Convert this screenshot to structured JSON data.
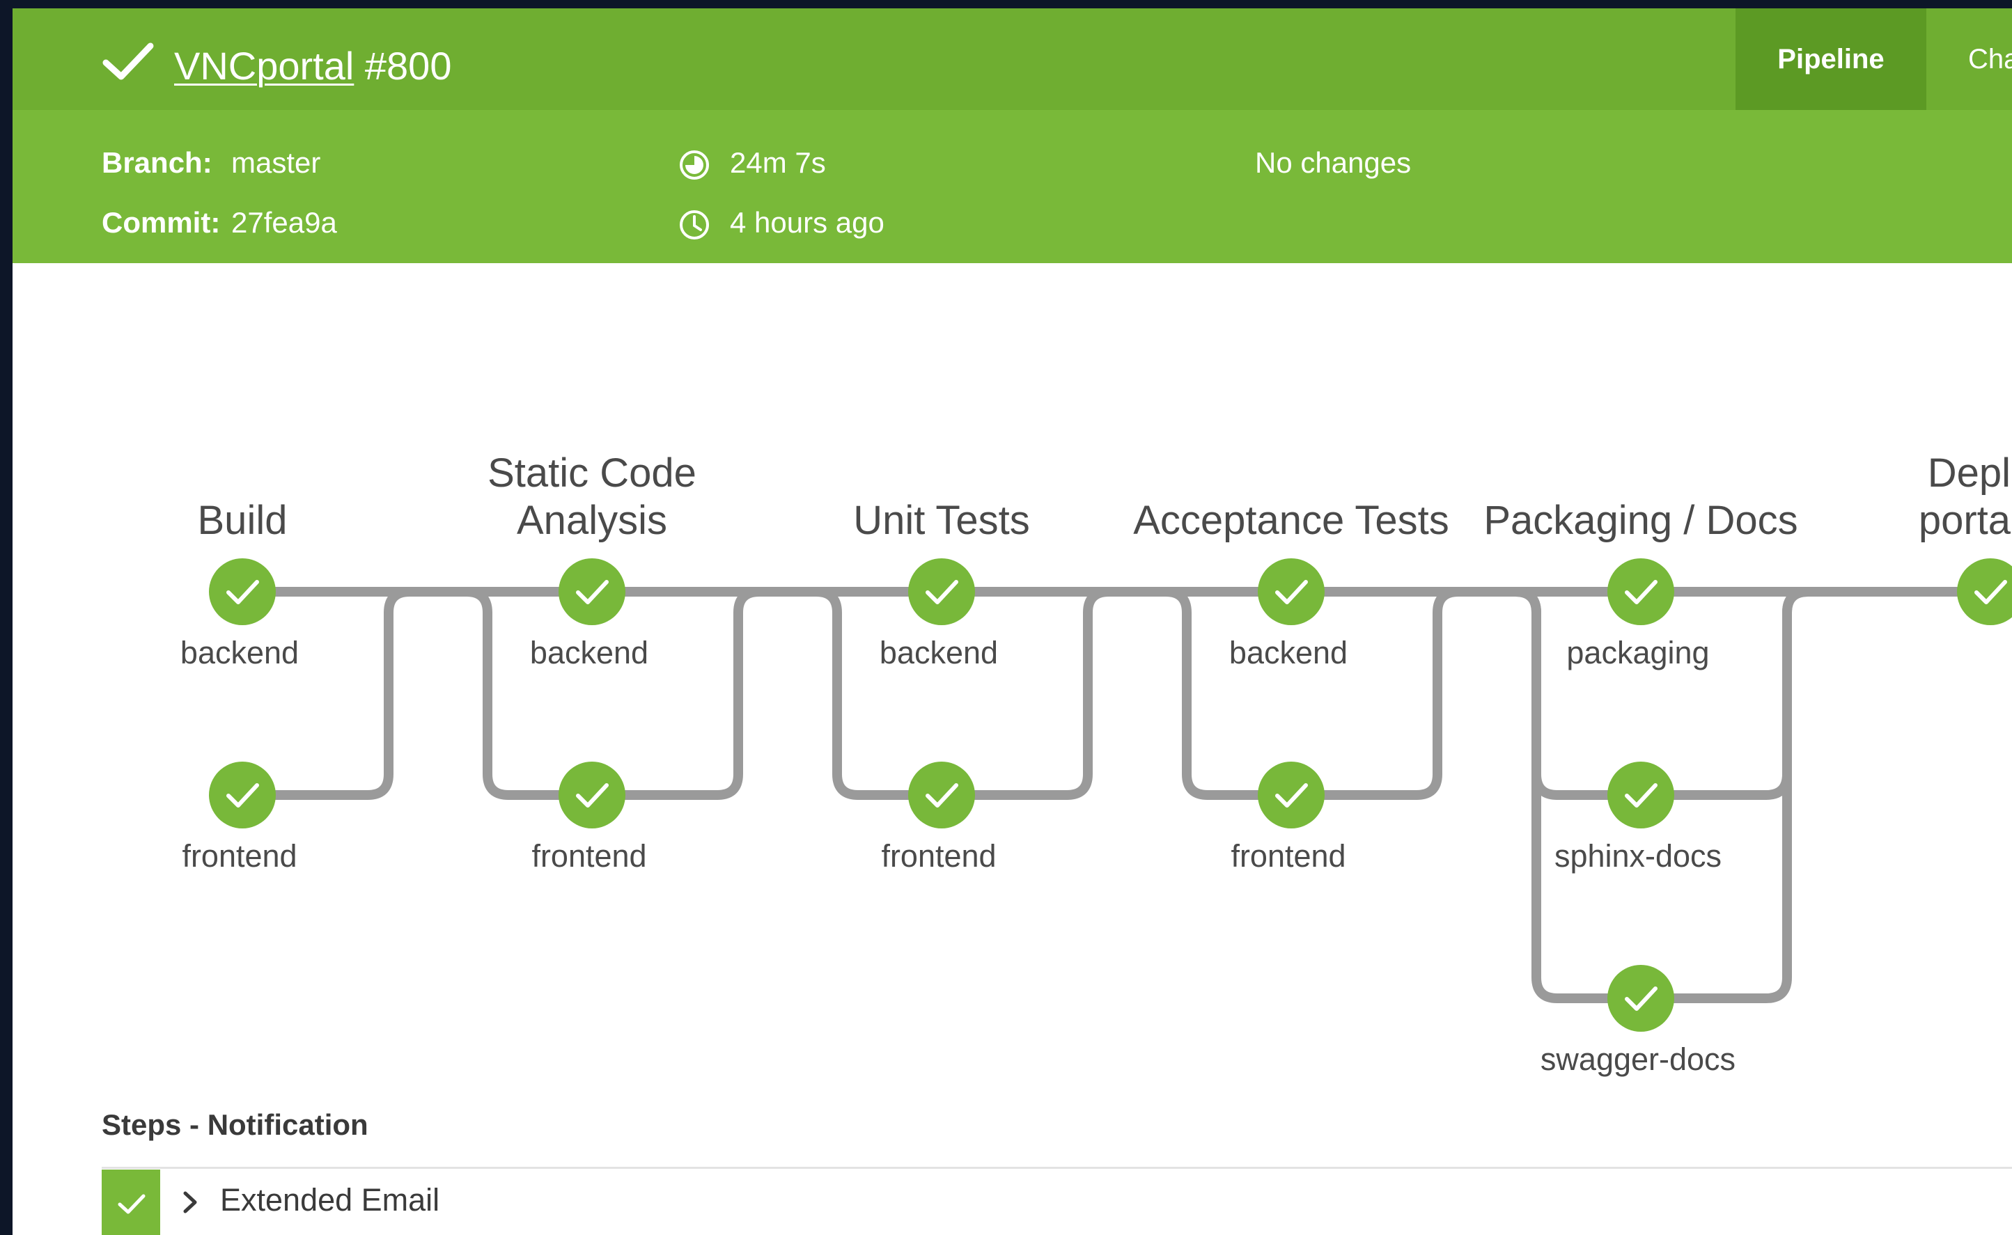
{
  "header": {
    "project_link": "VNCportal",
    "run_number": "#800",
    "tabs": [
      "Pipeline",
      "Cha"
    ]
  },
  "meta": {
    "branch_label": "Branch:",
    "branch_value": "master",
    "commit_label": "Commit:",
    "commit_value": "27fea9a",
    "duration": "24m 7s",
    "started": "4 hours ago",
    "changes": "No changes"
  },
  "pipeline": {
    "stages": [
      {
        "title": [
          "Build"
        ],
        "nodes": [
          "backend",
          "frontend"
        ]
      },
      {
        "title": [
          "Static Code",
          "Analysis"
        ],
        "nodes": [
          "backend",
          "frontend"
        ]
      },
      {
        "title": [
          "Unit Tests"
        ],
        "nodes": [
          "backend",
          "frontend"
        ]
      },
      {
        "title": [
          "Acceptance Tests"
        ],
        "nodes": [
          "backend",
          "frontend"
        ]
      },
      {
        "title": [
          "Packaging / Docs"
        ],
        "nodes": [
          "packaging",
          "sphinx-docs",
          "swagger-docs"
        ]
      },
      {
        "title": [
          "Deploy",
          "portal.vı"
        ],
        "nodes": []
      }
    ],
    "node_status": "success"
  },
  "steps": {
    "title": "Steps - Notification",
    "items": [
      {
        "label": "Extended Email",
        "status": "success"
      }
    ]
  },
  "colors": {
    "header_green": "#6fae31",
    "meta_green": "#79b939",
    "active_tab": "#5c9a24",
    "node_green": "#78b83a",
    "connector_gray": "#9a9a9a"
  }
}
